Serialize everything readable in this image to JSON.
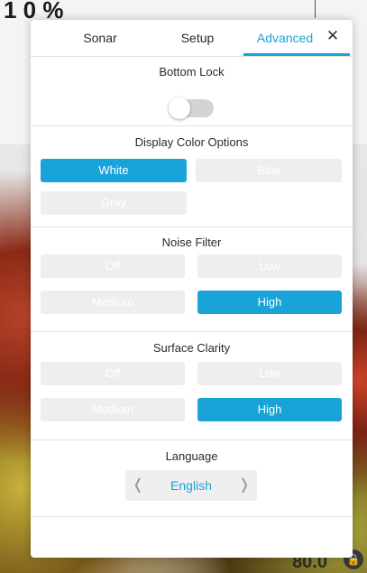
{
  "background": {
    "top_reading": "1 0 %",
    "depth_reading": "80.0"
  },
  "tabs": [
    {
      "label": "Sonar"
    },
    {
      "label": "Setup"
    },
    {
      "label": "Advanced"
    }
  ],
  "active_tab": "Advanced",
  "close_label": "✕",
  "bottom_lock": {
    "title": "Bottom Lock",
    "enabled": false
  },
  "display_color": {
    "title": "Display Color Options",
    "options": [
      "White",
      "Blue",
      "Gray"
    ],
    "selected": "White"
  },
  "noise_filter": {
    "title": "Noise Filter",
    "options": [
      "Off",
      "Low",
      "Medium",
      "High"
    ],
    "selected": "High"
  },
  "surface_clarity": {
    "title": "Surface Clarity",
    "options": [
      "Off",
      "Low",
      "Medium",
      "High"
    ],
    "selected": "High"
  },
  "language": {
    "title": "Language",
    "value": "English",
    "prev_label": "❬",
    "next_label": "❭"
  },
  "colors": {
    "accent": "#1aa3d9",
    "option_bg": "#eeeeee"
  }
}
